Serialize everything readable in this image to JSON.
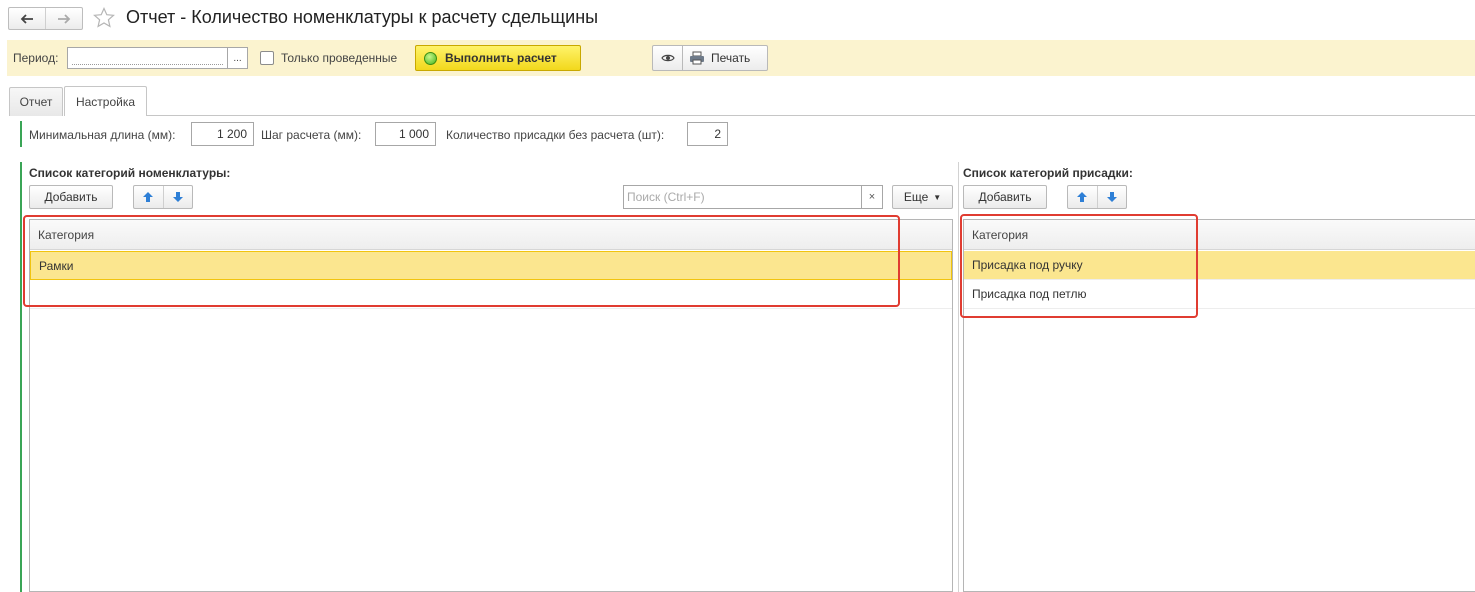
{
  "window": {
    "title": "Отчет - Количество номенклатуры к расчету сдельщины",
    "back_icon": "arrow-left-icon",
    "forward_icon": "arrow-right-icon",
    "favorite_icon": "star-icon"
  },
  "command_bar": {
    "period_label": "Период:",
    "period_value": "",
    "period_select_label": "...",
    "only_posted_label": "Только проведенные",
    "only_posted_checked": false,
    "run_label": "Выполнить расчет",
    "print_label": "Печать",
    "colors": {
      "background": "#fbf3cf",
      "run_button": "#f2d81c"
    }
  },
  "tabs": [
    {
      "label": "Отчет",
      "active": false
    },
    {
      "label": "Настройка",
      "active": true
    }
  ],
  "params": {
    "min_length_label": "Минимальная длина (мм):",
    "min_length_value": "1 200",
    "step_label": "Шаг расчета (мм):",
    "step_value": "1 000",
    "count_label": "Количество присадки без расчета (шт):",
    "count_value": "2"
  },
  "left_list": {
    "title": "Список категорий номенклатуры:",
    "add_label": "Добавить",
    "search_placeholder": "Поиск (Ctrl+F)",
    "search_clear": "×",
    "more_label": "Еще",
    "column_header": "Категория",
    "rows": [
      "Рамки"
    ]
  },
  "right_list": {
    "title": "Список категорий присадки:",
    "add_label": "Добавить",
    "column_header": "Категория",
    "rows": [
      "Присадка под ручку",
      "Присадка под петлю"
    ]
  },
  "colors": {
    "selection": "#fbe68f",
    "highlight_box": "#e03c31",
    "group_bar": "#3aa556"
  }
}
